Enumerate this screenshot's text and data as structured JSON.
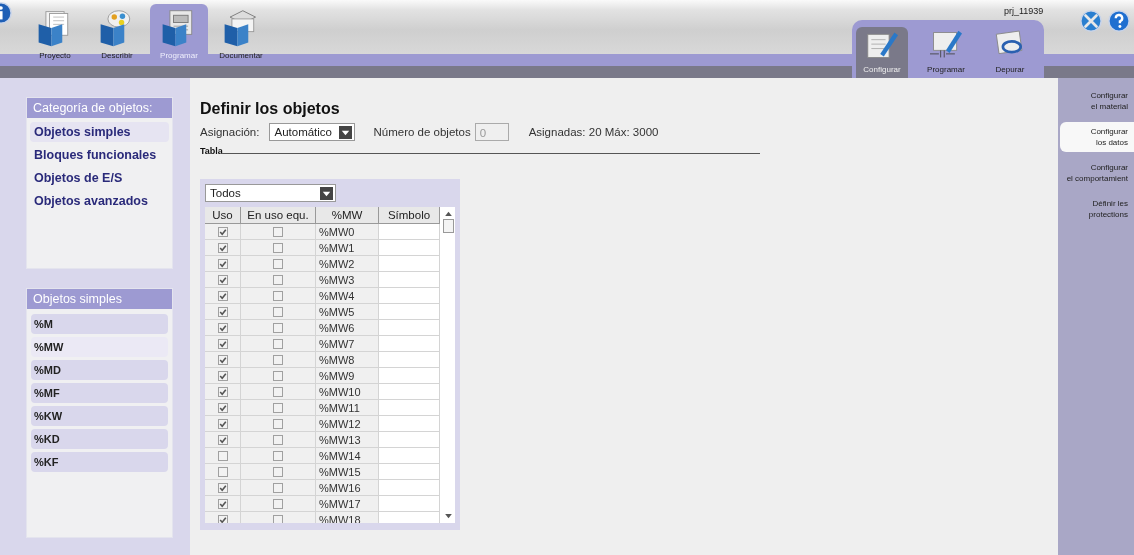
{
  "main_tabs": [
    {
      "label": "Proyecto",
      "selected": false
    },
    {
      "label": "Describir",
      "selected": false
    },
    {
      "label": "Programar",
      "selected": true
    },
    {
      "label": "Documentar",
      "selected": false
    }
  ],
  "project_name": "prj_11939",
  "mode_tabs": [
    {
      "label": "Configurar",
      "selected": true
    },
    {
      "label": "Programar",
      "selected": false
    },
    {
      "label": "Depurar",
      "selected": false
    }
  ],
  "side_tabs": [
    {
      "label": "Configurar\nel material",
      "selected": false
    },
    {
      "label": "Configurar\nlos datos",
      "selected": true
    },
    {
      "label": "Configurar\nel comportamient",
      "selected": false
    },
    {
      "label": "Définir les\nprotections",
      "selected": false
    }
  ],
  "category_panel": {
    "title": "Categoría de objetos:",
    "items": [
      {
        "label": "Objetos simples",
        "selected": true
      },
      {
        "label": "Bloques funcionales",
        "selected": false
      },
      {
        "label": "Objetos de E/S",
        "selected": false
      },
      {
        "label": "Objetos avanzados",
        "selected": false
      }
    ]
  },
  "objects_panel": {
    "title": "Objetos simples",
    "items": [
      {
        "label": "%M",
        "selected": false
      },
      {
        "label": "%MW",
        "selected": true
      },
      {
        "label": "%MD",
        "selected": false
      },
      {
        "label": "%MF",
        "selected": false
      },
      {
        "label": "%KW",
        "selected": false
      },
      {
        "label": "%KD",
        "selected": false
      },
      {
        "label": "%KF",
        "selected": false
      }
    ]
  },
  "content": {
    "title": "Definir los objetos",
    "assignment_label": "Asignación:",
    "assignment_value": "Automático",
    "count_label": "Número de objetos",
    "count_value": "0",
    "assigned_info": "Asignadas: 20  Máx: 3000",
    "group_label": "Tabla",
    "filter_value": "Todos"
  },
  "table": {
    "columns": [
      "Uso",
      "En uso equ.",
      "%MW",
      "Símbolo"
    ],
    "rows": [
      {
        "uso": true,
        "en_uso": false,
        "name": "%MW0"
      },
      {
        "uso": true,
        "en_uso": false,
        "name": "%MW1"
      },
      {
        "uso": true,
        "en_uso": false,
        "name": "%MW2"
      },
      {
        "uso": true,
        "en_uso": false,
        "name": "%MW3"
      },
      {
        "uso": true,
        "en_uso": false,
        "name": "%MW4"
      },
      {
        "uso": true,
        "en_uso": false,
        "name": "%MW5"
      },
      {
        "uso": true,
        "en_uso": false,
        "name": "%MW6"
      },
      {
        "uso": true,
        "en_uso": false,
        "name": "%MW7"
      },
      {
        "uso": true,
        "en_uso": false,
        "name": "%MW8"
      },
      {
        "uso": true,
        "en_uso": false,
        "name": "%MW9"
      },
      {
        "uso": true,
        "en_uso": false,
        "name": "%MW10"
      },
      {
        "uso": true,
        "en_uso": false,
        "name": "%MW11"
      },
      {
        "uso": true,
        "en_uso": false,
        "name": "%MW12"
      },
      {
        "uso": true,
        "en_uso": false,
        "name": "%MW13"
      },
      {
        "uso": false,
        "en_uso": false,
        "name": "%MW14"
      },
      {
        "uso": false,
        "en_uso": false,
        "name": "%MW15"
      },
      {
        "uso": true,
        "en_uso": false,
        "name": "%MW16"
      },
      {
        "uso": true,
        "en_uso": false,
        "name": "%MW17"
      },
      {
        "uso": true,
        "en_uso": false,
        "name": "%MW18"
      }
    ]
  }
}
